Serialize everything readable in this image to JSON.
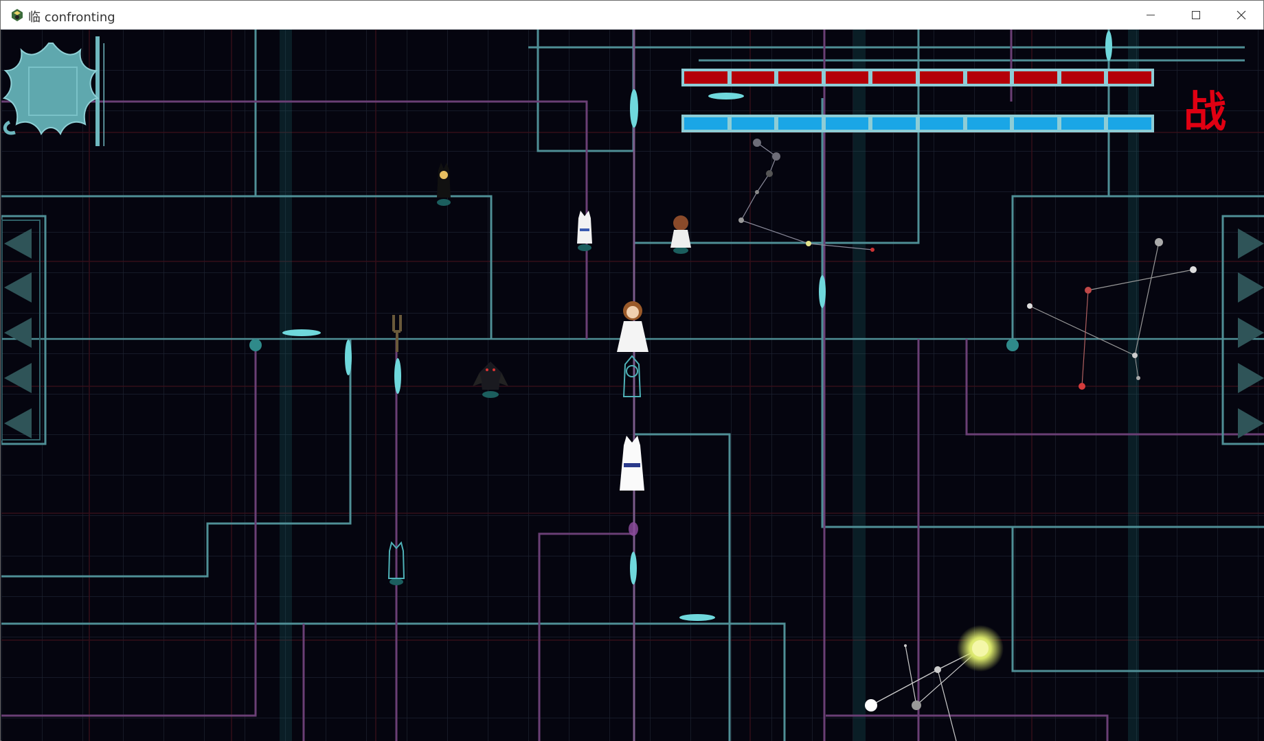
{
  "window": {
    "title": "临 confronting",
    "app_icon": "game-app-icon",
    "controls": {
      "minimize": "—",
      "maximize": "☐",
      "close": "✕"
    }
  },
  "hud": {
    "hp_segments": 10,
    "mp_segments": 10,
    "hp_color": "#b40008",
    "mp_color": "#1aa6e6",
    "frame_color": "#8ecdd6",
    "battle_label": "战",
    "battle_label_color": "#e00012"
  },
  "colors": {
    "background": "#05050f",
    "circuit_teal": "#4f8f96",
    "circuit_purple": "#6a3f75",
    "grid": "#1c2230",
    "grid_red": "#3a0f1a"
  }
}
